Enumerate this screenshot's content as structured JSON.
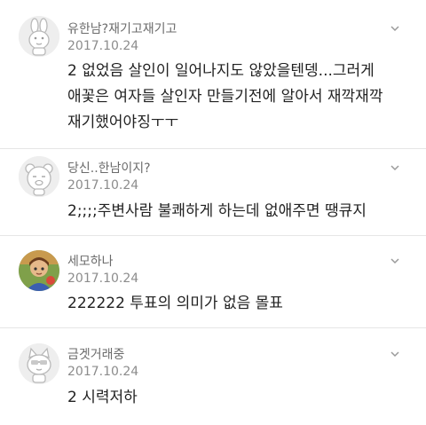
{
  "comments": [
    {
      "nickname": "유한남?재기고재기고",
      "date": "2017.10.24",
      "lines": [
        "2 없었음 살인이 일어나지도 않았을텐뎅...그러게",
        "애꽃은 여자들 살인자 만들기전에 알아서 재깍재깍",
        "재기했어야징ㅜㅜ"
      ],
      "avatar_icon": "rabbit-character-icon",
      "more_icon": "chevron-down-icon"
    },
    {
      "nickname": "당신..한남이지?",
      "date": "2017.10.24",
      "lines": [
        "2;;;;주변사람 불쾌하게 하는데 없애주면 땡큐지"
      ],
      "avatar_icon": "bear-character-icon",
      "more_icon": "chevron-down-icon"
    },
    {
      "nickname": "세모하나",
      "date": "2017.10.24",
      "lines": [
        "222222 투표의 의미가 없음 몰표"
      ],
      "avatar_icon": "photo-avatar",
      "more_icon": "chevron-down-icon"
    },
    {
      "nickname": "금겟거래중",
      "date": "2017.10.24",
      "lines": [
        "2 시력저하"
      ],
      "avatar_icon": "cat-character-icon",
      "more_icon": "chevron-down-icon"
    }
  ]
}
